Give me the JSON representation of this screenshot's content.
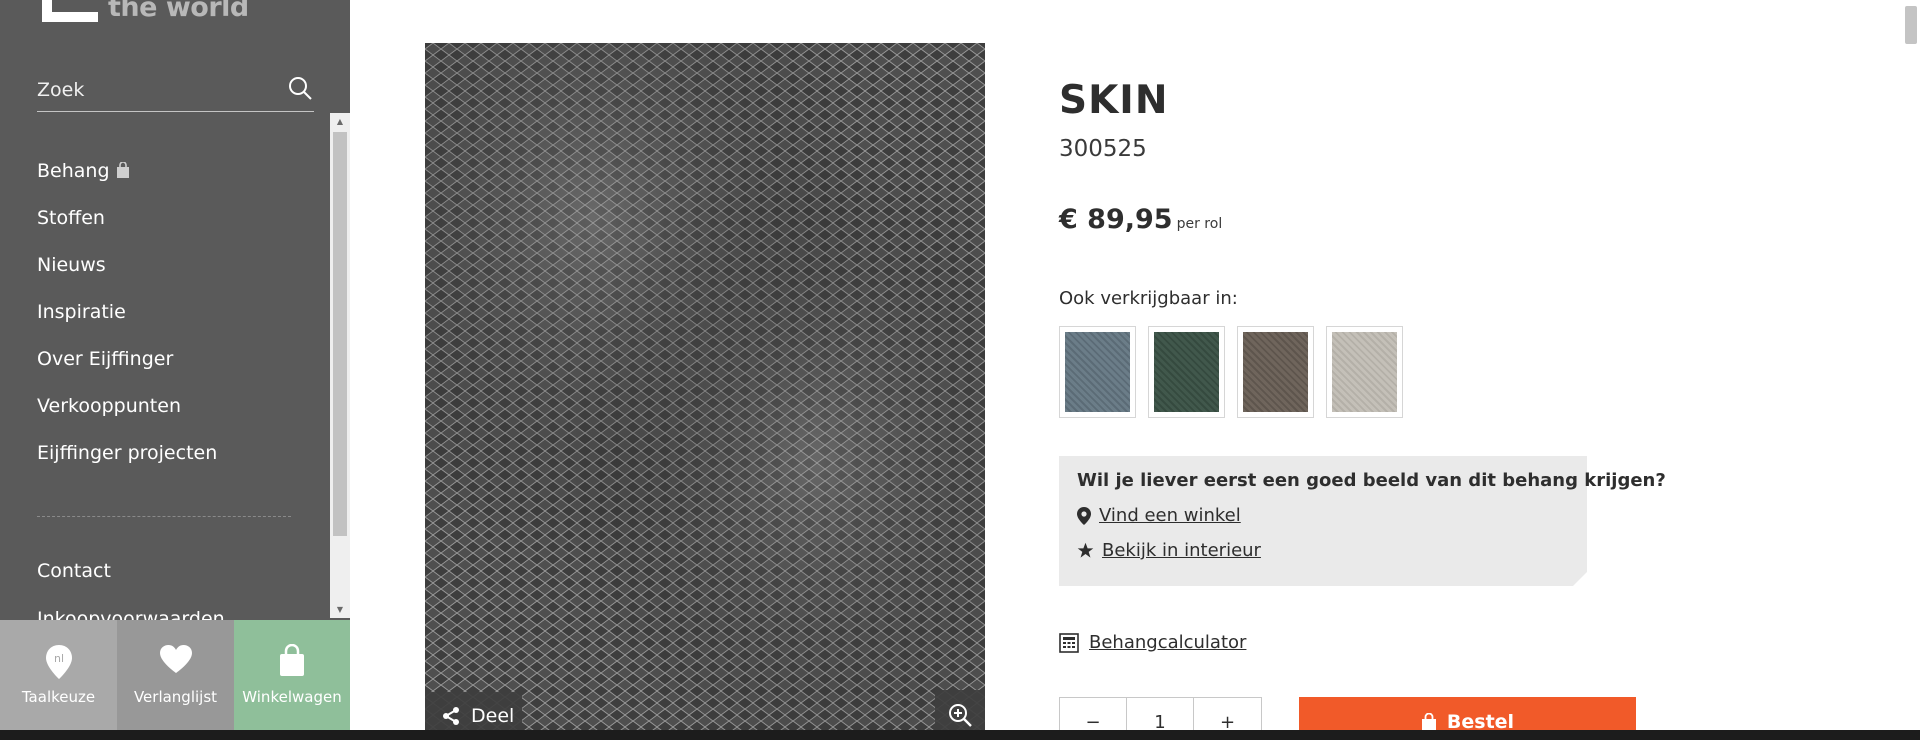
{
  "sidebar": {
    "logo_text": "the world",
    "search": {
      "placeholder": "Zoek"
    },
    "nav_items": [
      {
        "label": "Behang"
      },
      {
        "label": "Stoffen"
      },
      {
        "label": "Nieuws"
      },
      {
        "label": "Inspiratie"
      },
      {
        "label": "Over Eijffinger"
      },
      {
        "label": "Verkooppunten"
      },
      {
        "label": "Eijffinger projecten"
      }
    ],
    "contact_label": "Contact",
    "partial_item_label": "Inkoopvoorwaarden",
    "bottom_tabs": [
      {
        "label": "Taalkeuze",
        "icon": "location-pin-icon",
        "icon_text": "nl"
      },
      {
        "label": "Verlanglijst",
        "icon": "heart-icon"
      },
      {
        "label": "Winkelwagen",
        "icon": "shopping-bag-icon"
      }
    ]
  },
  "product": {
    "title": "SKIN",
    "sku": "300525",
    "price": "€ 89,95",
    "price_unit": "per rol",
    "also_available_label": "Ook verkrijgbaar in:",
    "variants": [
      {
        "color": "#6b7d88"
      },
      {
        "color": "#41584c"
      },
      {
        "color": "#6f655c"
      },
      {
        "color": "#c4c0b8"
      }
    ],
    "share_label": "Deel",
    "help_box": {
      "title": "Wil je liever eerst een goed beeld van dit behang krijgen?",
      "store_link": "Vind een winkel",
      "interior_link": "Bekijk in interieur"
    },
    "calculator_link": "Behangcalculator",
    "quantity": "1",
    "qty_minus": "−",
    "qty_plus": "+",
    "order_label": "Bestel"
  },
  "colors": {
    "sidebar_bg": "#5a5a5a",
    "cart_tab": "#8fbf9a",
    "order_button": "#f15a29"
  }
}
